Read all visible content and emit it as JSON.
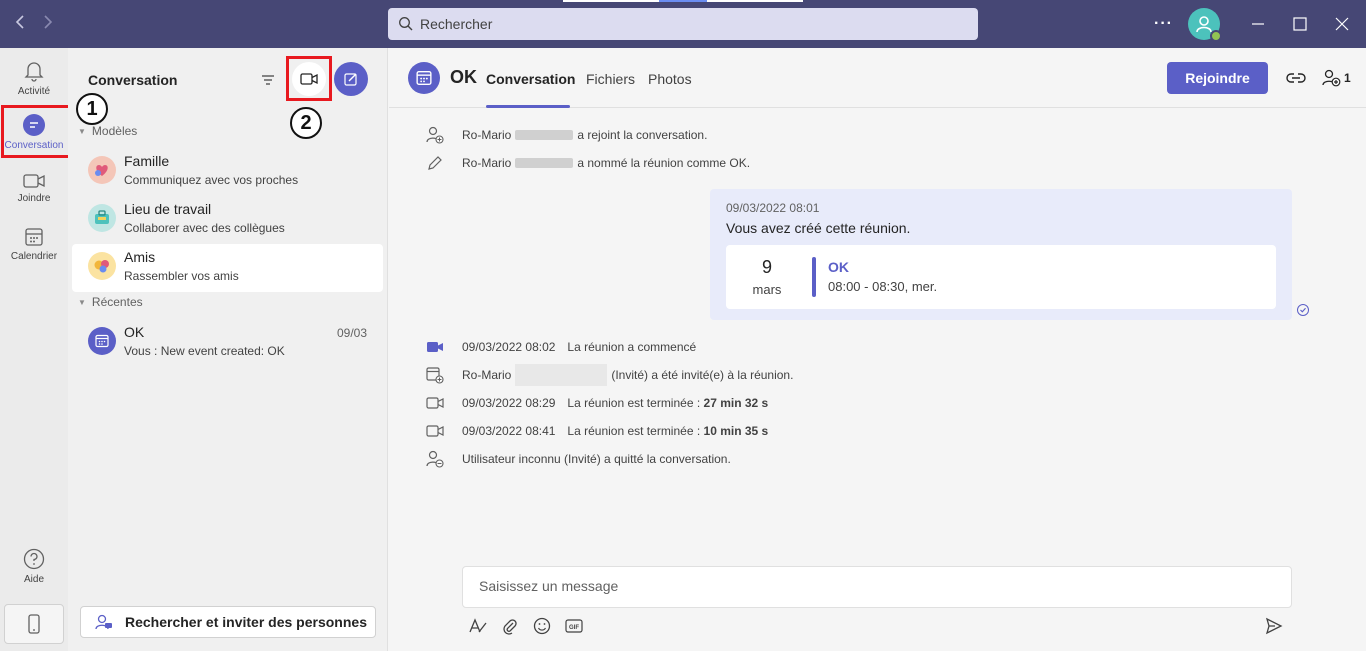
{
  "titlebar": {
    "back_icon": "chevron-left-icon",
    "forward_icon": "chevron-right-icon",
    "search_placeholder": "Rechercher",
    "more_label": "···"
  },
  "rail": {
    "items": [
      {
        "label": "Activité",
        "icon": "bell-icon"
      },
      {
        "label": "Conversation",
        "icon": "chat-icon"
      },
      {
        "label": "Joindre",
        "icon": "video-icon"
      },
      {
        "label": "Calendrier",
        "icon": "calendar-icon"
      },
      {
        "label": "Aide",
        "icon": "help-icon"
      }
    ]
  },
  "chatlist": {
    "title": "Conversation",
    "annotation_1": "1",
    "annotation_2": "2",
    "sections": {
      "models": "Modèles",
      "recent": "Récentes"
    },
    "models": [
      {
        "name": "Famille",
        "subtitle": "Communiquez avec vos proches"
      },
      {
        "name": "Lieu de travail",
        "subtitle": "Collaborer avec des collègues"
      },
      {
        "name": "Amis",
        "subtitle": "Rassembler vos amis"
      }
    ],
    "recent": [
      {
        "name": "OK",
        "subtitle": "Vous : New event created: OK",
        "date": "09/03"
      }
    ],
    "invite_button": "Rechercher et inviter des personnes"
  },
  "main": {
    "title": "OK",
    "tabs": [
      "Conversation",
      "Fichiers",
      "Photos"
    ],
    "join_button": "Rejoindre",
    "participant_count": "1",
    "system_messages": {
      "joined": {
        "name": "Ro-Mario",
        "text": "a rejoint la conversation."
      },
      "renamed": {
        "name": "Ro-Mario",
        "text": "a nommé la réunion comme OK."
      }
    },
    "bubble": {
      "timestamp": "09/03/2022 08:01",
      "text": "Vous avez créé cette réunion.",
      "event": {
        "day": "9",
        "month": "mars",
        "title": "OK",
        "time": "08:00 - 08:30, mer."
      }
    },
    "events": [
      {
        "time": "09/03/2022 08:02",
        "text": "La réunion a commencé",
        "bold": ""
      },
      {
        "time": "Ro-Mario",
        "text": "(Invité) a été invité(e) à la réunion.",
        "bold": ""
      },
      {
        "time": "09/03/2022 08:29",
        "text": "La réunion est terminée :",
        "bold": "27 min 32 s"
      },
      {
        "time": "09/03/2022 08:41",
        "text": "La réunion est terminée :",
        "bold": "10 min 35 s"
      },
      {
        "time": "",
        "text": "Utilisateur inconnu (Invité) a quitté la conversation.",
        "bold": ""
      }
    ],
    "composer_placeholder": "Saisissez un message"
  },
  "colors": {
    "titlebar": "#464775",
    "accent": "#5b5fc7",
    "highlight": "#e8191f"
  }
}
